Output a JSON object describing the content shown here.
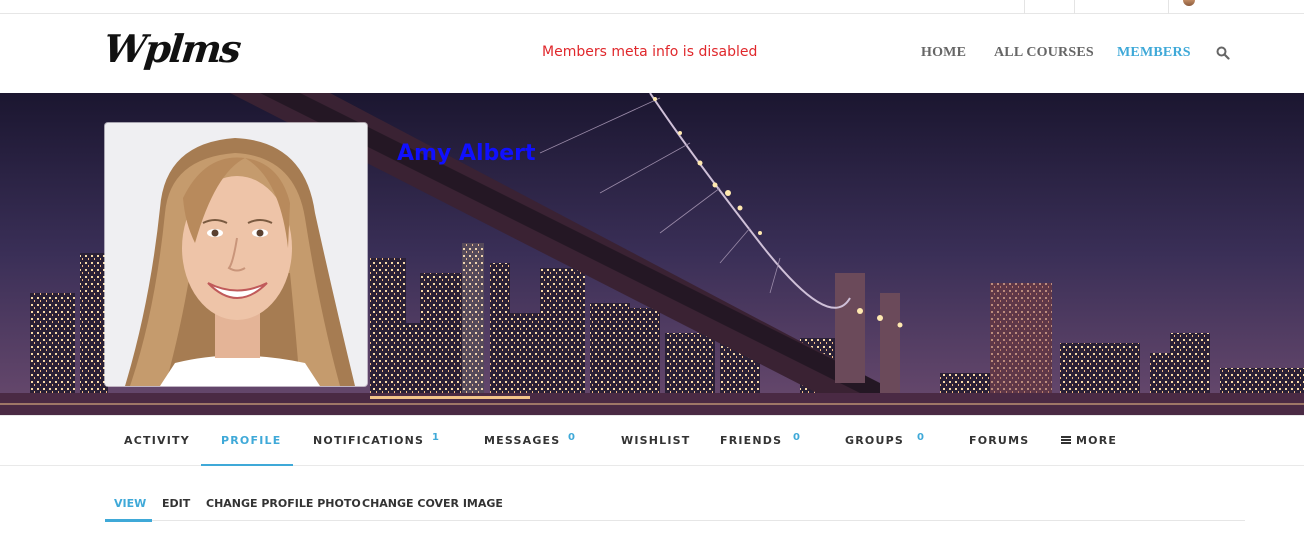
{
  "header": {
    "logo_text": "Wplms",
    "notice": "Members meta info is disabled",
    "nav": [
      {
        "label": "HOME",
        "active": false
      },
      {
        "label": "ALL COURSES",
        "active": false
      },
      {
        "label": "MEMBERS",
        "active": true
      }
    ],
    "search_icon": "search-icon"
  },
  "profile": {
    "name": "Amy Albert",
    "avatar_icon": "member-avatar-photo"
  },
  "tabs": [
    {
      "label": "ACTIVITY",
      "count": null,
      "active": false
    },
    {
      "label": "PROFILE",
      "count": null,
      "active": true
    },
    {
      "label": "NOTIFICATIONS",
      "count": "1",
      "active": false
    },
    {
      "label": "MESSAGES",
      "count": "0",
      "active": false
    },
    {
      "label": "WISHLIST",
      "count": null,
      "active": false
    },
    {
      "label": "FRIENDS",
      "count": "0",
      "active": false
    },
    {
      "label": "GROUPS",
      "count": "0",
      "active": false
    },
    {
      "label": "FORUMS",
      "count": null,
      "active": false
    },
    {
      "label": "MORE",
      "count": null,
      "active": false
    }
  ],
  "subtabs": [
    {
      "label": "VIEW",
      "active": true
    },
    {
      "label": "EDIT",
      "active": false
    },
    {
      "label": "CHANGE PROFILE PHOTO",
      "active": false
    },
    {
      "label": "CHANGE COVER IMAGE",
      "active": false
    }
  ],
  "colors": {
    "accent": "#3fa9d8",
    "notice": "#e0282c",
    "name": "#1010ff"
  }
}
